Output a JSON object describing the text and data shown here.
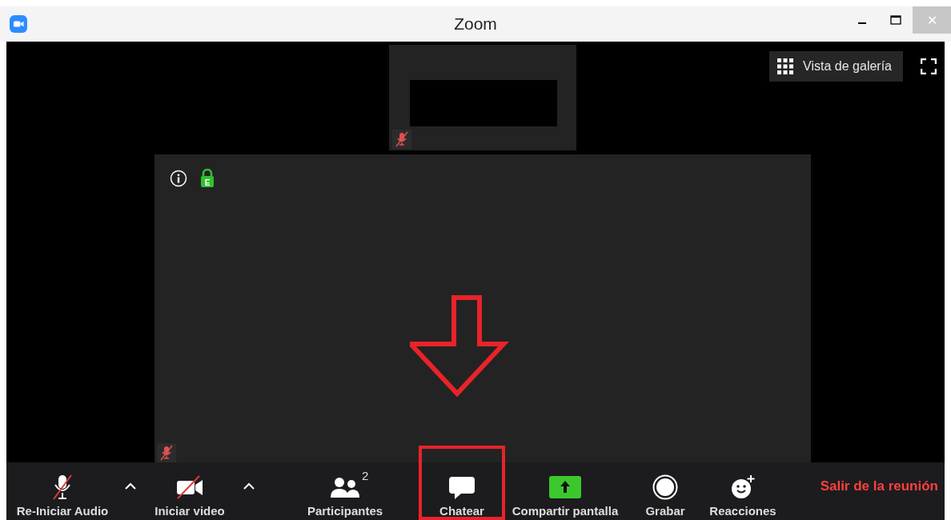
{
  "window": {
    "title": "Zoom",
    "close_glyph": "✕"
  },
  "view_controls": {
    "gallery_button": "Vista de galería"
  },
  "video_tiles": [
    {
      "kind": "thumbnail",
      "muted": true,
      "redacted": true
    },
    {
      "kind": "main",
      "muted": true,
      "encryption_badge": "E"
    }
  ],
  "annotations": [
    {
      "kind": "down-arrow"
    }
  ],
  "toolbar": [
    {
      "kind": "audio",
      "label": "Re-Iniciar Audio",
      "off": true,
      "menu_caret": true,
      "highlighted": false
    },
    {
      "kind": "video",
      "label": "Iniciar video",
      "off": true,
      "menu_caret": true,
      "highlighted": false
    },
    {
      "kind": "participants",
      "label": "Participantes",
      "count": "2",
      "highlighted": false
    },
    {
      "kind": "chat",
      "label": "Chatear",
      "highlighted": true
    },
    {
      "kind": "share",
      "label": "Compartir pantalla",
      "highlighted": false
    },
    {
      "kind": "record",
      "label": "Grabar",
      "highlighted": false
    },
    {
      "kind": "reactions",
      "label": "Reacciones",
      "highlighted": false
    }
  ],
  "leave_button": "Salir de la reunión"
}
